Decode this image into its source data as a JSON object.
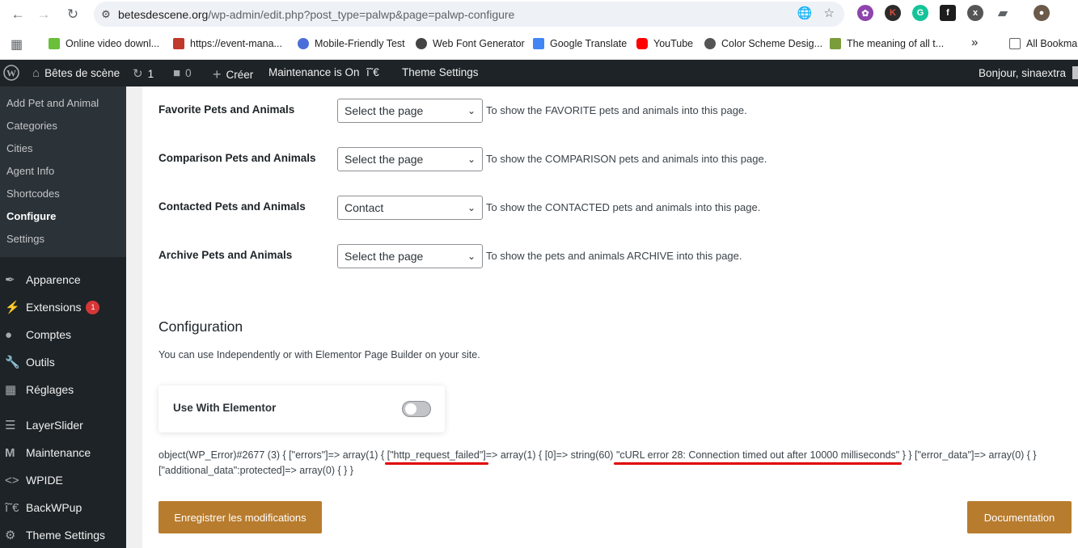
{
  "browser": {
    "url_domain": "betesdescene.org",
    "url_path": "/wp-admin/edit.php?post_type=palwp&page=palwp-configure",
    "bookmarks": [
      {
        "label": "Online video downl...",
        "color": "#6abf3b"
      },
      {
        "label": "https://event-mana...",
        "color": "#c0392b"
      },
      {
        "label": "Mobile-Friendly Test",
        "color": "#4a6fd8"
      },
      {
        "label": "Web Font Generator",
        "color": "#444444"
      },
      {
        "label": "Google Translate",
        "color": "#4285f4"
      },
      {
        "label": "YouTube",
        "color": "#ff0000"
      },
      {
        "label": "Color Scheme Desig...",
        "color": "#555555"
      },
      {
        "label": "The meaning of all t...",
        "color": "#7a9c3b"
      }
    ],
    "all_bookmarks": "All Bookma",
    "more": "»"
  },
  "adminbar": {
    "site_name": "Bêtes de scène",
    "updates_count": "1",
    "comments_count": "0",
    "create_label": "Créer",
    "maintenance_label": "Maintenance is On",
    "glyph_label": "î˜€",
    "theme_settings": "Theme Settings",
    "greeting": "Bonjour, sinaextra"
  },
  "sidebar": {
    "submenu": [
      {
        "label": "Add Pet and Animal"
      },
      {
        "label": "Categories"
      },
      {
        "label": "Cities"
      },
      {
        "label": "Agent Info"
      },
      {
        "label": "Shortcodes"
      },
      {
        "label": "Configure"
      },
      {
        "label": "Settings"
      }
    ],
    "menu": [
      {
        "label": "Apparence",
        "icon": "brush-icon"
      },
      {
        "label": "Extensions",
        "icon": "plugin-icon",
        "badge": "1"
      },
      {
        "label": "Comptes",
        "icon": "user-icon"
      },
      {
        "label": "Outils",
        "icon": "wrench-icon"
      },
      {
        "label": "Réglages",
        "icon": "settings-icon"
      },
      {
        "label": "LayerSlider",
        "icon": "layers-icon"
      },
      {
        "label": "Maintenance",
        "icon": "m-icon"
      },
      {
        "label": "WPIDE",
        "icon": "code-icon"
      },
      {
        "label": "BackWPup",
        "icon": "glyph-icon",
        "glyph": "î˜€"
      },
      {
        "label": "Theme Settings",
        "icon": "gear-icon"
      }
    ]
  },
  "main": {
    "rows": [
      {
        "label": "Favorite Pets and Animals",
        "value": "Select the page",
        "desc": "To show the FAVORITE pets and animals into this page."
      },
      {
        "label": "Comparison Pets and Animals",
        "value": "Select the page",
        "desc": "To show the COMPARISON pets and animals into this page."
      },
      {
        "label": "Contacted Pets and Animals",
        "value": "Contact",
        "desc": "To show the CONTACTED pets and animals into this page."
      },
      {
        "label": "Archive Pets and Animals",
        "value": "Select the page",
        "desc": "To show the pets and animals ARCHIVE into this page."
      }
    ],
    "config_title": "Configuration",
    "config_desc": "You can use Independently or with Elementor Page Builder on your site.",
    "toggle_label": "Use With Elementor",
    "toggle_on": false,
    "error_line1_a": "object(WP_Error)#2677 (3) { [\"errors\"]=> array(1) { ",
    "error_hl1": "[\"http_request_failed\"]",
    "error_line1_b": "=> array(1) { [0]=> string(60) ",
    "error_hl2": "\"cURL error 28: Connection timed out after 10000 milliseconds\"",
    "error_line1_c": " } } [\"error_data\"]=> array(0) { }",
    "error_line2": "[\"additional_data\":protected]=> array(0) { } }",
    "save_button": "Enregistrer les modifications",
    "doc_button": "Documentation",
    "accent_color": "#b87c2e"
  }
}
